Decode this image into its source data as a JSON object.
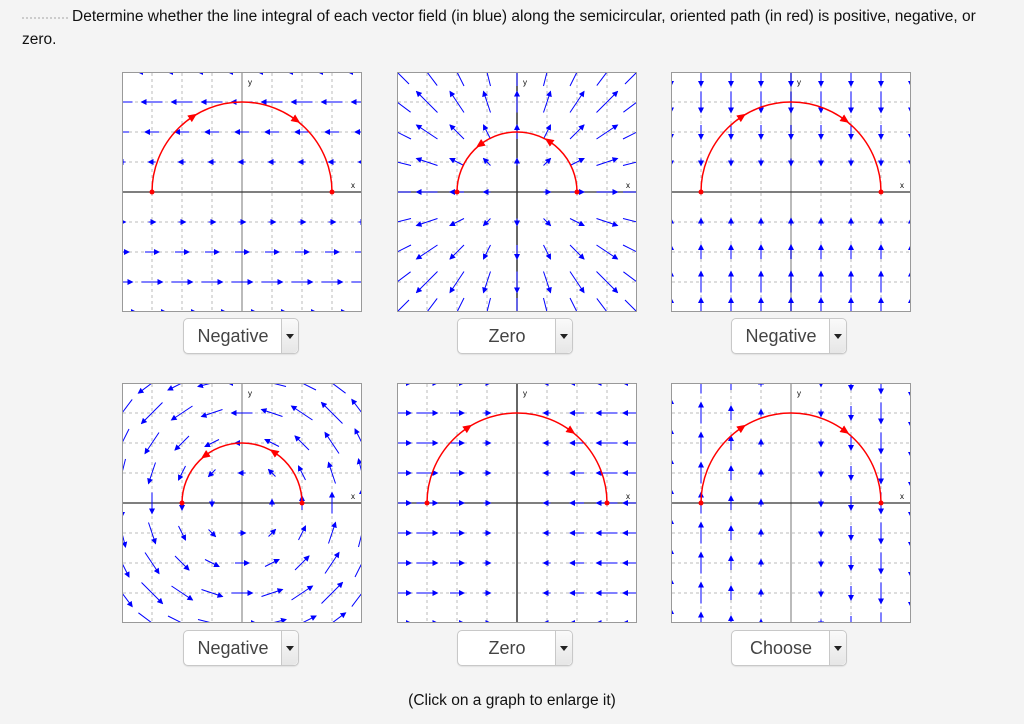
{
  "prompt": "Determine whether the line integral of each vector field (in blue) along the semicircular, oriented path (in red) is positive, negative, or zero.",
  "colors": {
    "field": "#0000ff",
    "path": "#ff0000",
    "grid": "#bbbbbb",
    "axis": "#333333"
  },
  "axis_labels": {
    "x": "x",
    "y": "y"
  },
  "graphs": [
    {
      "field": "F(x,y) = (-y, 0)",
      "radius": 3,
      "orientation": "clockwise",
      "answer": "Negative"
    },
    {
      "field": "F(x,y) = (x, y)",
      "radius": 2,
      "orientation": "counterclockwise",
      "answer": "Zero"
    },
    {
      "field": "F(x,y) = (0, -y)",
      "radius": 3,
      "orientation": "clockwise",
      "answer": "Negative"
    },
    {
      "field": "F(x,y) = (-y, x)",
      "radius": 2,
      "orientation": "counterclockwise",
      "answer": "Negative"
    },
    {
      "field": "F(x,y) = (-x, 0)",
      "radius": 3,
      "orientation": "clockwise",
      "answer": "Zero"
    },
    {
      "field": "F(x,y) = (0, -x)",
      "radius": 3,
      "orientation": "clockwise",
      "answer": "Choose"
    }
  ],
  "footer": "(Click on a graph to enlarge it)"
}
